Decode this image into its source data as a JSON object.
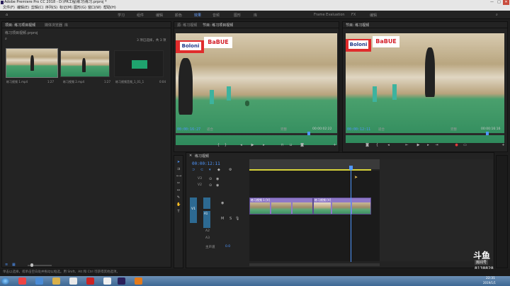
{
  "window": {
    "title": "Adobe Premiere Pro CC 2018 - D:\\PR工程\\练习\\练习.prproj *",
    "minimize_glyph": "—",
    "maximize_glyph": "□",
    "close_glyph": "✕"
  },
  "menu": [
    "文件(F)",
    "编辑(E)",
    "剪辑(C)",
    "序列(S)",
    "标记(M)",
    "图形(G)",
    "窗口(W)",
    "帮助(H)"
  ],
  "workspaces": {
    "items": [
      "学习",
      "组件",
      "编辑",
      "颜色",
      "效果",
      "音频",
      "图形",
      "库",
      "Frame Evaluation",
      "FX",
      "编辑"
    ],
    "active_index": 3
  },
  "project_panel": {
    "tabs": [
      "项目: 练习项目视频",
      "媒体浏览器",
      "库"
    ],
    "active_tab": 0,
    "path": "练习项目视频.prproj",
    "search_icon": "magnifier-icon",
    "item_count": "3 项已选择，共 3 项",
    "items": [
      {
        "name": "练习视频 1.mp4",
        "duration": "1:27"
      },
      {
        "name": "练习视频 2.mp4",
        "duration": "1:27"
      },
      {
        "name": "练习视频音频_1_01_1",
        "duration": "0:04"
      }
    ]
  },
  "source_monitor": {
    "tabs": [
      "源: 练习视频",
      "节目: 练习项目视频"
    ],
    "active_tab": 1,
    "banner_left": "Boloni",
    "banner_right": "BaBUE",
    "timecode": "00:00:16:27",
    "fit": "适合",
    "quality": "完整",
    "duration": "00:00:02:22"
  },
  "program_monitor": {
    "title": "节目: 练习视频",
    "banner_left": "Boloni",
    "banner_right": "BaBUE",
    "timecode": "00:00:12:11",
    "fit": "适合",
    "quality": "完整",
    "duration": "00:00:16:16"
  },
  "timeline": {
    "title": "练习视频",
    "timecode": "00:00:12:11",
    "video_tracks": [
      "V3",
      "V2",
      "V1"
    ],
    "audio_tracks": [
      "A1",
      "A2",
      "A3"
    ],
    "master": "主声道",
    "master_value": "0.0",
    "clips": [
      {
        "label": "练习视频 1 [V]"
      },
      {
        "label": "练习视频 [V]"
      }
    ]
  },
  "status": {
    "hint": "单击以选择，或单击空白处并拖动以框选。用 Shift、Alt 和 Ctrl 可获得其他选项。"
  },
  "watermark": {
    "brand": "斗鱼",
    "sub": "房间号",
    "room": "8138828"
  },
  "clock": {
    "time": "22:31",
    "date": "2019/1/1"
  },
  "taskbar_icons": [
    "start-orb-icon",
    "browser-icon",
    "explorer-icon",
    "media-icon",
    "ie-icon",
    "folder-icon",
    "chrome-icon",
    "douyu-icon",
    "premiere-icon",
    "premiere-icon",
    "record-icon"
  ]
}
